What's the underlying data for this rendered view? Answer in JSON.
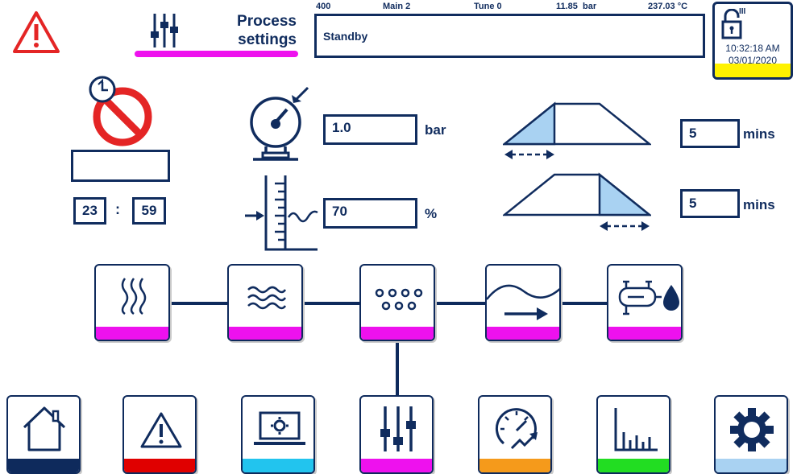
{
  "header": {
    "title_line1": "Process",
    "title_line2": "settings",
    "status_text": "Standby",
    "info": {
      "code": "400",
      "main": "Main 2",
      "tune": "Tune 0",
      "pressure": "11.85  bar",
      "temperature": "237.03 °C"
    },
    "lock_level": "III",
    "time": "10:32:18 AM",
    "date": "03/01/2020"
  },
  "schedule": {
    "name_value": "",
    "hours": "23",
    "separator": ":",
    "minutes": "59"
  },
  "setpoints": {
    "pressure_value": "1.0",
    "pressure_unit": "bar",
    "level_value": "70",
    "level_unit": "%",
    "ramp_up_value": "5",
    "ramp_up_unit": "mins",
    "ramp_down_value": "5",
    "ramp_down_unit": "mins"
  },
  "colors": {
    "navy": "#102c5e",
    "magenta": "#ee11ee",
    "alarm_red": "#e42525",
    "home": "#0e2a5c",
    "alarms": "#e00000",
    "system": "#22c4ee",
    "process": "#ee11ee",
    "performance": "#f59a1b",
    "trends": "#22dd22",
    "settings": "#a9d2f2",
    "lock_yellow": "#fff200"
  },
  "process_steps": [
    {
      "icon": "heat-icon"
    },
    {
      "icon": "water-waves-icon"
    },
    {
      "icon": "dots-grid-icon"
    },
    {
      "icon": "flow-arrow-icon"
    },
    {
      "icon": "heat-exchanger-icon"
    }
  ],
  "nav": [
    {
      "icon": "home-icon"
    },
    {
      "icon": "alarm-icon"
    },
    {
      "icon": "system-screen-icon"
    },
    {
      "icon": "sliders-icon"
    },
    {
      "icon": "performance-gauge-icon"
    },
    {
      "icon": "trends-chart-icon"
    },
    {
      "icon": "gear-icon"
    }
  ]
}
